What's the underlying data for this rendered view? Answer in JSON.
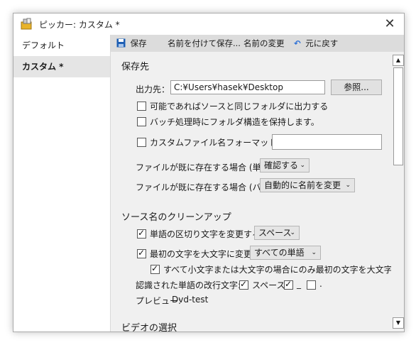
{
  "window": {
    "title": "ピッカー: カスタム *",
    "close_glyph": "✕"
  },
  "sidebar": {
    "items": [
      {
        "label": "デフォルト"
      },
      {
        "label": "カスタム *"
      }
    ]
  },
  "toolbar": {
    "save": "保存",
    "save_as": "名前を付けて保存...",
    "rename": "名前の変更",
    "undo": "元に戻す"
  },
  "save_section": {
    "title": "保存先",
    "output_label": "出力先：",
    "output_value": "C:¥Users¥hasek¥Desktop",
    "browse": "参照...",
    "same_folder": "可能であればソースと同じフォルダに出力する",
    "keep_structure": "バッチ処理時にフォルダ構造を保持します。",
    "custom_format": "カスタムファイル名フォーマットを使用:",
    "custom_format_value": "",
    "exists_single_label": "ファイルが既に存在する場合 (単体):",
    "exists_single_value": "確認する",
    "exists_batch_label": "ファイルが既に存在する場合 (バッチ):",
    "exists_batch_value": "自動的に名前を変更"
  },
  "cleanup_section": {
    "title": "ソース名のクリーンアップ",
    "change_sep": "単語の区切り文字を変更する",
    "sep_value": "スペース",
    "capitalize": "最初の文字を大文字に変更",
    "capitalize_value": "すべての単語",
    "only_if_case": "すべて小文字または大文字の場合にのみ最初の文字を大文字にし",
    "breaks_label": "認識された単語の改行文字:",
    "break_space": "スペース",
    "break_underscore": "_",
    "break_dot": ".",
    "preview_label": "プレビュー:",
    "preview_value": "Dvd-test"
  },
  "video_section": {
    "title": "ビデオの選択"
  },
  "colors": {
    "accent": "#1e5fb4",
    "undo": "#2b6fd6",
    "toolbar_bg": "#dcdcdc"
  }
}
